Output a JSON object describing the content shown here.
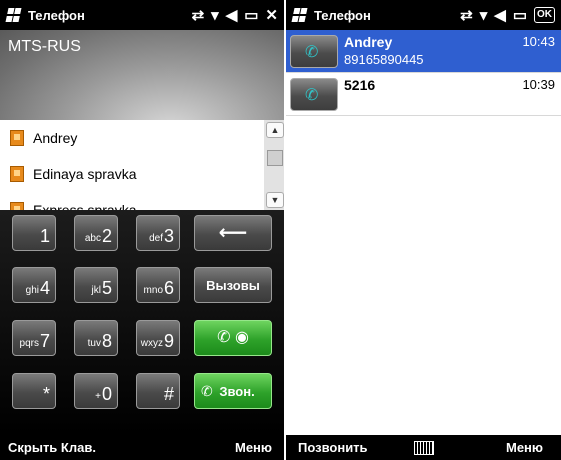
{
  "left": {
    "status": {
      "title": "Телефон",
      "icons": [
        "network-arrows-icon",
        "signal-icon",
        "speaker-icon",
        "battery-icon",
        "close-icon"
      ]
    },
    "carrier": "MTS-RUS",
    "contacts": [
      {
        "name": "Andrey"
      },
      {
        "name": "Edinaya spravka"
      },
      {
        "name": "Express spravka"
      }
    ],
    "keys": [
      {
        "sub": "",
        "main": "1"
      },
      {
        "sub": "abc",
        "main": "2"
      },
      {
        "sub": "def",
        "main": "3"
      },
      {
        "sub": "ghi",
        "main": "4"
      },
      {
        "sub": "jkl",
        "main": "5"
      },
      {
        "sub": "mno",
        "main": "6"
      },
      {
        "sub": "pqrs",
        "main": "7"
      },
      {
        "sub": "tuv",
        "main": "8"
      },
      {
        "sub": "wxyz",
        "main": "9"
      },
      {
        "sub": "",
        "main": "*"
      },
      {
        "sub": "+",
        "main": "0"
      },
      {
        "sub": "",
        "main": "#"
      }
    ],
    "side_keys": {
      "backspace": "⟵",
      "calls": "Вызовы",
      "video_call": "",
      "dial": "Звон."
    },
    "softkeys": {
      "left": "Скрыть Клав.",
      "right": "Меню"
    }
  },
  "right": {
    "status": {
      "title": "Телефон",
      "ok": "OK",
      "icons": [
        "network-arrows-icon",
        "signal-icon",
        "speaker-icon",
        "battery-icon"
      ]
    },
    "calls": [
      {
        "name": "Andrey",
        "number": "89165890445",
        "time": "10:43",
        "selected": true
      },
      {
        "name": "5216",
        "number": "",
        "time": "10:39",
        "selected": false
      }
    ],
    "softkeys": {
      "left": "Позвонить",
      "right": "Меню"
    }
  },
  "colors": {
    "selection": "#2f5fd0",
    "green_key": "#2ea22a"
  }
}
